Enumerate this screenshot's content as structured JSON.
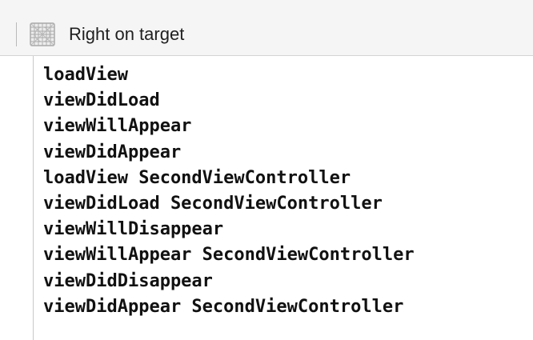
{
  "toolbar": {
    "scheme_icon": "grid-scheme-icon",
    "target_label": "Right on target"
  },
  "console": {
    "lines": [
      "loadView",
      "viewDidLoad",
      "viewWillAppear",
      "viewDidAppear",
      "loadView SecondViewController",
      "viewDidLoad SecondViewController",
      "viewWillDisappear",
      "viewWillAppear SecondViewController",
      "viewDidDisappear",
      "viewDidAppear SecondViewController"
    ]
  },
  "colors": {
    "toolbar_background": "#f5f5f5",
    "console_background": "#ffffff",
    "text": "#111111",
    "divider": "#c8c8c8"
  }
}
